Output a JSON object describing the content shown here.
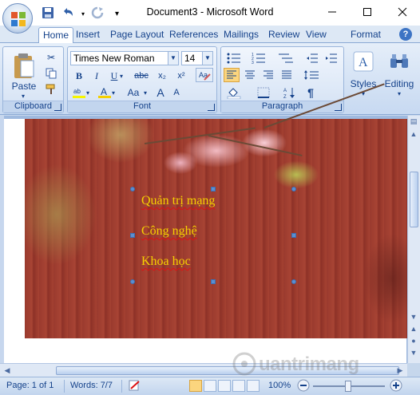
{
  "window": {
    "title": "Document3 - Microsoft Word",
    "controls": {
      "minimize": "—",
      "maximize": "☐",
      "close": "✕"
    }
  },
  "qat": {
    "save": "save-icon",
    "undo": "undo-icon",
    "redo": "redo-icon",
    "customize": "▾"
  },
  "tabs": [
    {
      "label": "Home",
      "active": true
    },
    {
      "label": "Insert"
    },
    {
      "label": "Page Layout"
    },
    {
      "label": "References"
    },
    {
      "label": "Mailings"
    },
    {
      "label": "Review"
    },
    {
      "label": "View"
    },
    {
      "label": "Format"
    }
  ],
  "ribbon": {
    "clipboard": {
      "label": "Clipboard",
      "paste": "Paste"
    },
    "font": {
      "label": "Font",
      "font_name": "Times New Roman",
      "font_size": "14",
      "bold": "B",
      "italic": "I",
      "underline": "U",
      "strike": "abc",
      "subscript": "x₂",
      "superscript": "x²",
      "grow": "A",
      "shrink": "A",
      "case": "Aa"
    },
    "paragraph": {
      "label": "Paragraph",
      "pilcrow": "¶"
    },
    "styles": {
      "label": "Styles"
    },
    "editing": {
      "label": "Editing"
    }
  },
  "document": {
    "lines": [
      "Quản trị mạng",
      "Công nghệ",
      "Khoa học"
    ]
  },
  "status": {
    "page": "Page: 1 of 1",
    "words": "Words: 7/7",
    "zoom": "100%"
  },
  "colors": {
    "text": "#f5d000",
    "accent": "#15428b"
  }
}
